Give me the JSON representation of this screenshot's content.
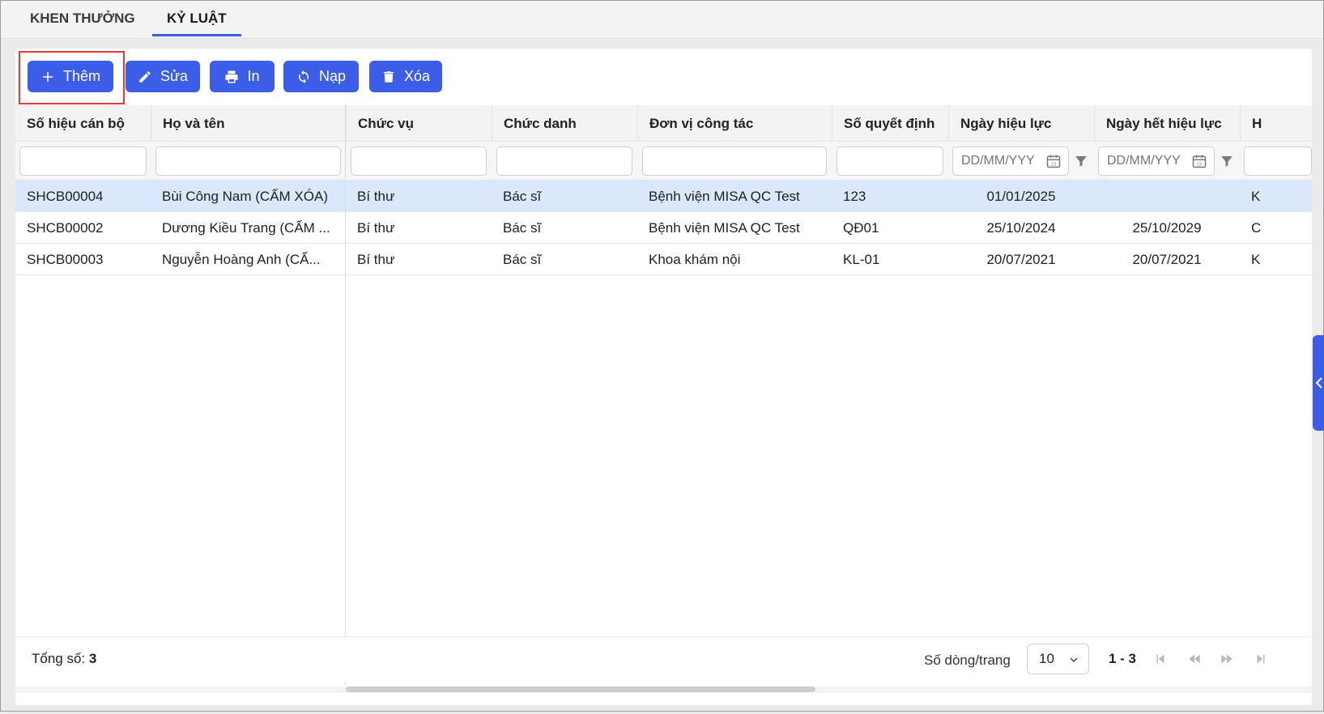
{
  "tabs": [
    {
      "label": "KHEN THƯỞNG",
      "active": false
    },
    {
      "label": "KỶ LUẬT",
      "active": true
    }
  ],
  "toolbar": {
    "add_label": "Thêm",
    "edit_label": "Sửa",
    "print_label": "In",
    "reload_label": "Nạp",
    "delete_label": "Xóa"
  },
  "table": {
    "columns": [
      "Số hiệu cán bộ",
      "Họ và tên",
      "Chức vụ",
      "Chức danh",
      "Đơn vị công tác",
      "Số quyết định",
      "Ngày hiệu lực",
      "Ngày hết hiệu lực",
      "H"
    ],
    "date_placeholder": "DD/MM/YYY",
    "rows": [
      {
        "code": "SHCB00004",
        "name": "Bùi Công Nam (CẤM XÓA)",
        "position": "Bí thư",
        "title": "Bác sĩ",
        "unit": "Bệnh viện MISA QC Test",
        "decision": "123",
        "effective": "01/01/2025",
        "expiry": "",
        "extra": "K",
        "selected": true
      },
      {
        "code": "SHCB00002",
        "name": "Dương Kiều Trang (CẤM ...",
        "position": "Bí thư",
        "title": "Bác sĩ",
        "unit": "Bệnh viện MISA QC Test",
        "decision": "QĐ01",
        "effective": "25/10/2024",
        "expiry": "25/10/2029",
        "extra": "C",
        "selected": false
      },
      {
        "code": "SHCB00003",
        "name": "Nguyễn Hoàng Anh (CẤ...",
        "position": "Bí thư",
        "title": "Bác sĩ",
        "unit": "Khoa khám nội",
        "decision": "KL-01",
        "effective": "20/07/2021",
        "expiry": "20/07/2021",
        "extra": "K",
        "selected": false
      }
    ]
  },
  "footer": {
    "total_label": "Tổng số:",
    "total_value": "3",
    "rows_per_page_label": "Số dòng/trang",
    "rows_per_page": "10",
    "range": "1 - 3"
  },
  "colors": {
    "accent": "#3b5de7",
    "selected_row": "#dbe8fb",
    "highlight_border": "#e53935"
  }
}
